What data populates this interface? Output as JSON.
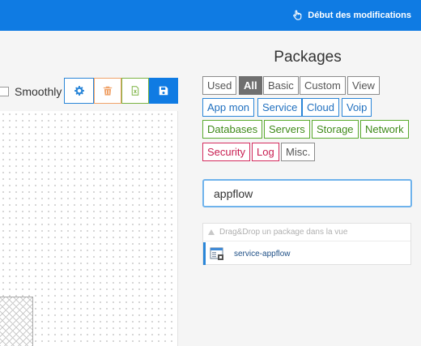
{
  "topbar": {
    "action_label": "Début des modifications",
    "action_icon": "hand-pointer-icon"
  },
  "toolbar": {
    "smoothly_label": "Smoothly",
    "smoothly_checked": false,
    "buttons": [
      {
        "icon": "gear-icon",
        "color": "#2a86d8"
      },
      {
        "icon": "trash-icon",
        "color": "#f0a36a"
      },
      {
        "icon": "excel-icon",
        "color": "#7cb342"
      },
      {
        "icon": "floppy-disk-icon",
        "color": "#0f7be3"
      }
    ]
  },
  "packages": {
    "title": "Packages",
    "filters_row1": [
      {
        "label": "Used",
        "style": "grey"
      },
      {
        "label": "All",
        "style": "grey-active"
      },
      {
        "label": "Basic",
        "style": "grey"
      },
      {
        "label": "Custom",
        "style": "grey"
      },
      {
        "label": "View",
        "style": "grey"
      }
    ],
    "filters_row2": [
      {
        "label": "App mon",
        "style": "blue"
      },
      {
        "label": "Service",
        "style": "blue"
      },
      {
        "label": "Cloud",
        "style": "blue"
      },
      {
        "label": "Voip",
        "style": "blue"
      }
    ],
    "filters_row3": [
      {
        "label": "Databases",
        "style": "green"
      },
      {
        "label": "Servers",
        "style": "green"
      },
      {
        "label": "Storage",
        "style": "green"
      },
      {
        "label": "Network",
        "style": "green"
      }
    ],
    "filters_row4": [
      {
        "label": "Security",
        "style": "red"
      },
      {
        "label": "Log",
        "style": "red"
      },
      {
        "label": "Misc.",
        "style": "grey"
      }
    ],
    "search_value": "appflow",
    "drop_hint": "Drag&Drop un package dans la vue",
    "results": [
      {
        "name": "service-appflow",
        "icon": "service-package-icon"
      }
    ]
  }
}
